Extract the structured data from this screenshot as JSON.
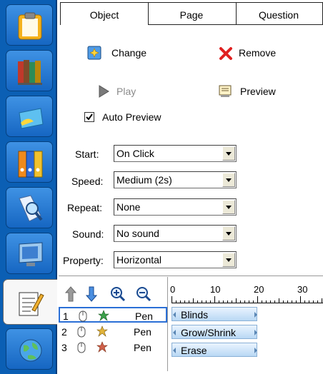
{
  "sidebar": {
    "items": [
      {
        "name": "clipboard-icon",
        "active": false
      },
      {
        "name": "books-icon",
        "active": false
      },
      {
        "name": "card-icon",
        "active": false
      },
      {
        "name": "binders-icon",
        "active": false
      },
      {
        "name": "magnifier-icon",
        "active": false
      },
      {
        "name": "monitor-icon",
        "active": false
      },
      {
        "name": "notepad-pencil-icon",
        "active": true
      },
      {
        "name": "globe-icon",
        "active": false
      }
    ]
  },
  "tabs": [
    {
      "label": "Object",
      "active": true
    },
    {
      "label": "Page",
      "active": false
    },
    {
      "label": "Question",
      "active": false
    }
  ],
  "actions": {
    "change_label": "Change",
    "remove_label": "Remove",
    "play_label": "Play",
    "preview_label": "Preview"
  },
  "auto_preview": {
    "label": "Auto Preview",
    "checked": true
  },
  "fields": {
    "start": {
      "label": "Start:",
      "value": "On Click"
    },
    "speed": {
      "label": "Speed:",
      "value": "Medium (2s)"
    },
    "repeat": {
      "label": "Repeat:",
      "value": "None"
    },
    "sound": {
      "label": "Sound:",
      "value": "No sound"
    },
    "property": {
      "label": "Property:",
      "value": "Horizontal"
    }
  },
  "timeline": {
    "ruler": [
      "0",
      "10",
      "20",
      "30"
    ],
    "items": [
      {
        "num": "1",
        "name": "Pen",
        "effect": "Blinds"
      },
      {
        "num": "2",
        "name": "Pen",
        "effect": "Grow/Shrink"
      },
      {
        "num": "3",
        "name": "Pen",
        "effect": "Erase"
      }
    ]
  },
  "colors": {
    "sidebar": "#0b5fb4",
    "accent": "#2a6fd6",
    "remove": "#e02020"
  }
}
